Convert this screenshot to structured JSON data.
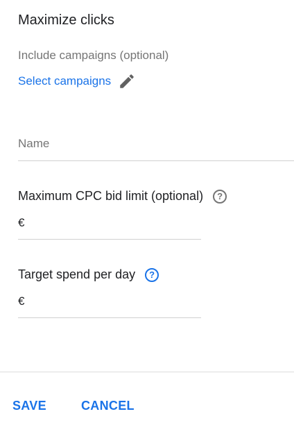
{
  "panel": {
    "title": "Maximize clicks"
  },
  "campaigns": {
    "label": "Include campaigns (optional)",
    "link": "Select campaigns",
    "edit_icon": "pencil-icon"
  },
  "name_field": {
    "placeholder": "Name",
    "value": ""
  },
  "max_cpc": {
    "label": "Maximum CPC bid limit (optional)",
    "currency": "€",
    "value": "",
    "help_icon": "help-circle-icon"
  },
  "target_spend": {
    "label": "Target spend per day",
    "currency": "€",
    "value": "",
    "help_icon": "help-circle-icon"
  },
  "actions": {
    "save": "SAVE",
    "cancel": "CANCEL"
  },
  "colors": {
    "accent": "#1a73e8",
    "text": "#202124",
    "muted": "#757575",
    "divider": "#dcdcdc"
  }
}
